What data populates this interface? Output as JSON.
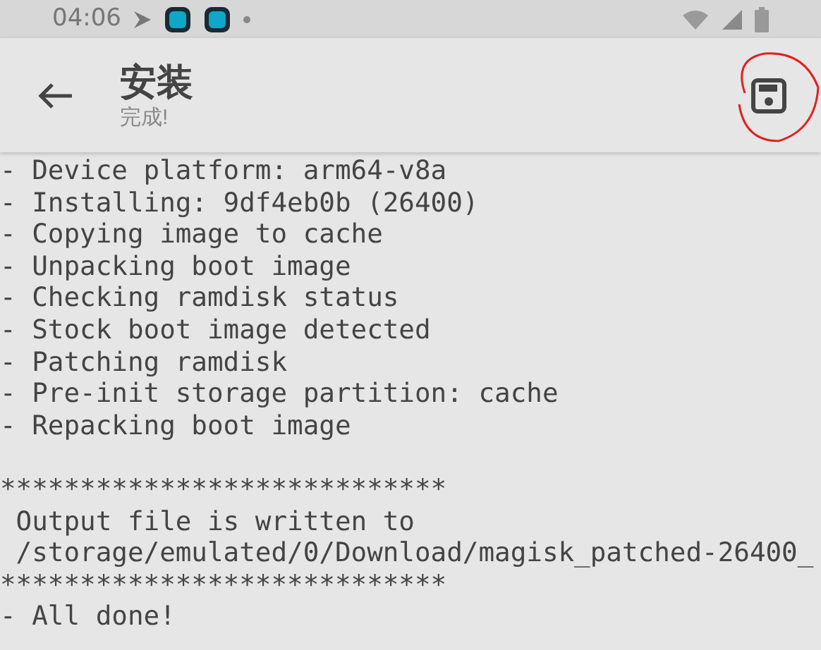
{
  "status_bar": {
    "time": "04:06"
  },
  "app_bar": {
    "title": "安装",
    "subtitle": "完成!"
  },
  "log": [
    {
      "kind": "line",
      "text": "- Device platform: arm64-v8a"
    },
    {
      "kind": "line",
      "text": "- Installing: 9df4eb0b (26400)"
    },
    {
      "kind": "line",
      "text": "- Copying image to cache"
    },
    {
      "kind": "line",
      "text": "- Unpacking boot image"
    },
    {
      "kind": "line",
      "text": "- Checking ramdisk status"
    },
    {
      "kind": "line",
      "text": "- Stock boot image detected"
    },
    {
      "kind": "line",
      "text": "- Patching ramdisk"
    },
    {
      "kind": "line",
      "text": "- Pre-init storage partition: cache"
    },
    {
      "kind": "line",
      "text": "- Repacking boot image"
    },
    {
      "kind": "blank"
    },
    {
      "kind": "line",
      "text": "****************************"
    },
    {
      "kind": "line",
      "text": " Output file is written to"
    },
    {
      "kind": "line",
      "text": " /storage/emulated/0/Download/magisk_patched-26400_"
    },
    {
      "kind": "line",
      "text": "****************************"
    },
    {
      "kind": "line",
      "text": "- All done!"
    }
  ]
}
